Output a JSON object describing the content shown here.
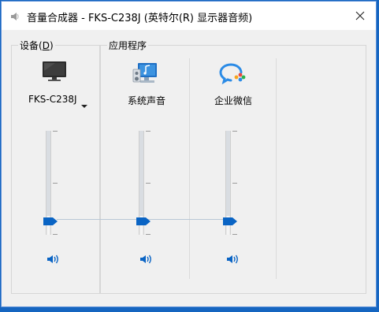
{
  "window": {
    "title": "音量合成器 - FKS-C238J (英特尔(R) 显示器音频)"
  },
  "device_group": {
    "label_prefix": "设备(",
    "label_accel": "D",
    "label_suffix": ")",
    "device_name": "FKS-C238J",
    "icon": "monitor-icon",
    "volume": 0.18
  },
  "apps_group": {
    "label": "应用程序"
  },
  "apps": [
    {
      "label": "系统声音",
      "icon": "system-sounds-icon",
      "volume": 0.18
    },
    {
      "label": "企业微信",
      "icon": "wecom-icon",
      "volume": 0.18
    }
  ],
  "colors": {
    "accent": "#0a64c4",
    "titlebar": "#ffffff",
    "client": "#f0f0f0"
  }
}
